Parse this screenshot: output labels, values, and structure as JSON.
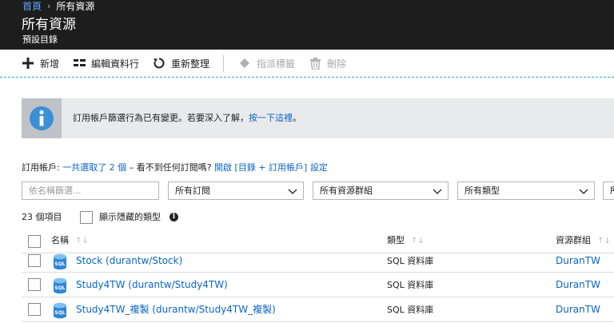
{
  "breadcrumb": {
    "home": "首頁",
    "separator": "›",
    "current": "所有資源"
  },
  "header": {
    "title": "所有資源",
    "subtitle": "預設目錄"
  },
  "toolbar": {
    "add_label": "新增",
    "add_icon": "plus-icon",
    "edit_columns_label": "編輯資料行",
    "edit_columns_icon": "columns-icon",
    "refresh_label": "重新整理",
    "refresh_icon": "refresh-icon",
    "assign_tags_label": "指派標籤",
    "assign_tags_icon": "tag-icon",
    "delete_label": "刪除",
    "delete_icon": "trash-icon"
  },
  "info_bar": {
    "icon": "info-icon",
    "text": "訂用帳戶篩選行為已有變更。若要深入了解，",
    "link": "按一下這裡",
    "suffix": "。"
  },
  "subscriptions": {
    "label": "訂用帳戶:",
    "selected_link": "一共選取了 2 個",
    "middle": "– 看不到任何訂閱嗎?",
    "open_link": "開啟 [目錄 + 訂用帳戶] 設定"
  },
  "filters": {
    "name_placeholder": "依名稱篩選...",
    "subscription": "所有訂閱",
    "resource_group": "所有資源群組",
    "type": "所有類型",
    "location_partial": "所"
  },
  "list": {
    "count": "23 個項目",
    "show_hidden_label": "顯示隱藏的類型",
    "columns": {
      "name": "名稱",
      "type": "類型",
      "resource_group": "資源群組"
    },
    "sort_glyph": "↑↓",
    "rows": [
      {
        "name": "Stock (durantw/Stock)",
        "type": "SQL 資料庫",
        "resource_group": "DuranTW"
      },
      {
        "name": "Study4TW (durantw/Study4TW)",
        "type": "SQL 資料庫",
        "resource_group": "DuranTW"
      },
      {
        "name": "Study4TW_複製 (durantw/Study4TW_複製)",
        "type": "SQL 資料庫",
        "resource_group": "DuranTW"
      }
    ],
    "row_icon": "sql-database-icon",
    "icon_text": "SQL"
  },
  "colors": {
    "header_bg": "#1d1d1d",
    "link": "#0b66c3",
    "breadcrumb_link": "#58a6ff",
    "info_bg": "#e9eaeb",
    "info_icon_bg": "#bfc3c7",
    "info_circle": "#3b8fd6",
    "toolbar_divider": "#2aa6b9",
    "sql_icon": "#2f86d4"
  }
}
